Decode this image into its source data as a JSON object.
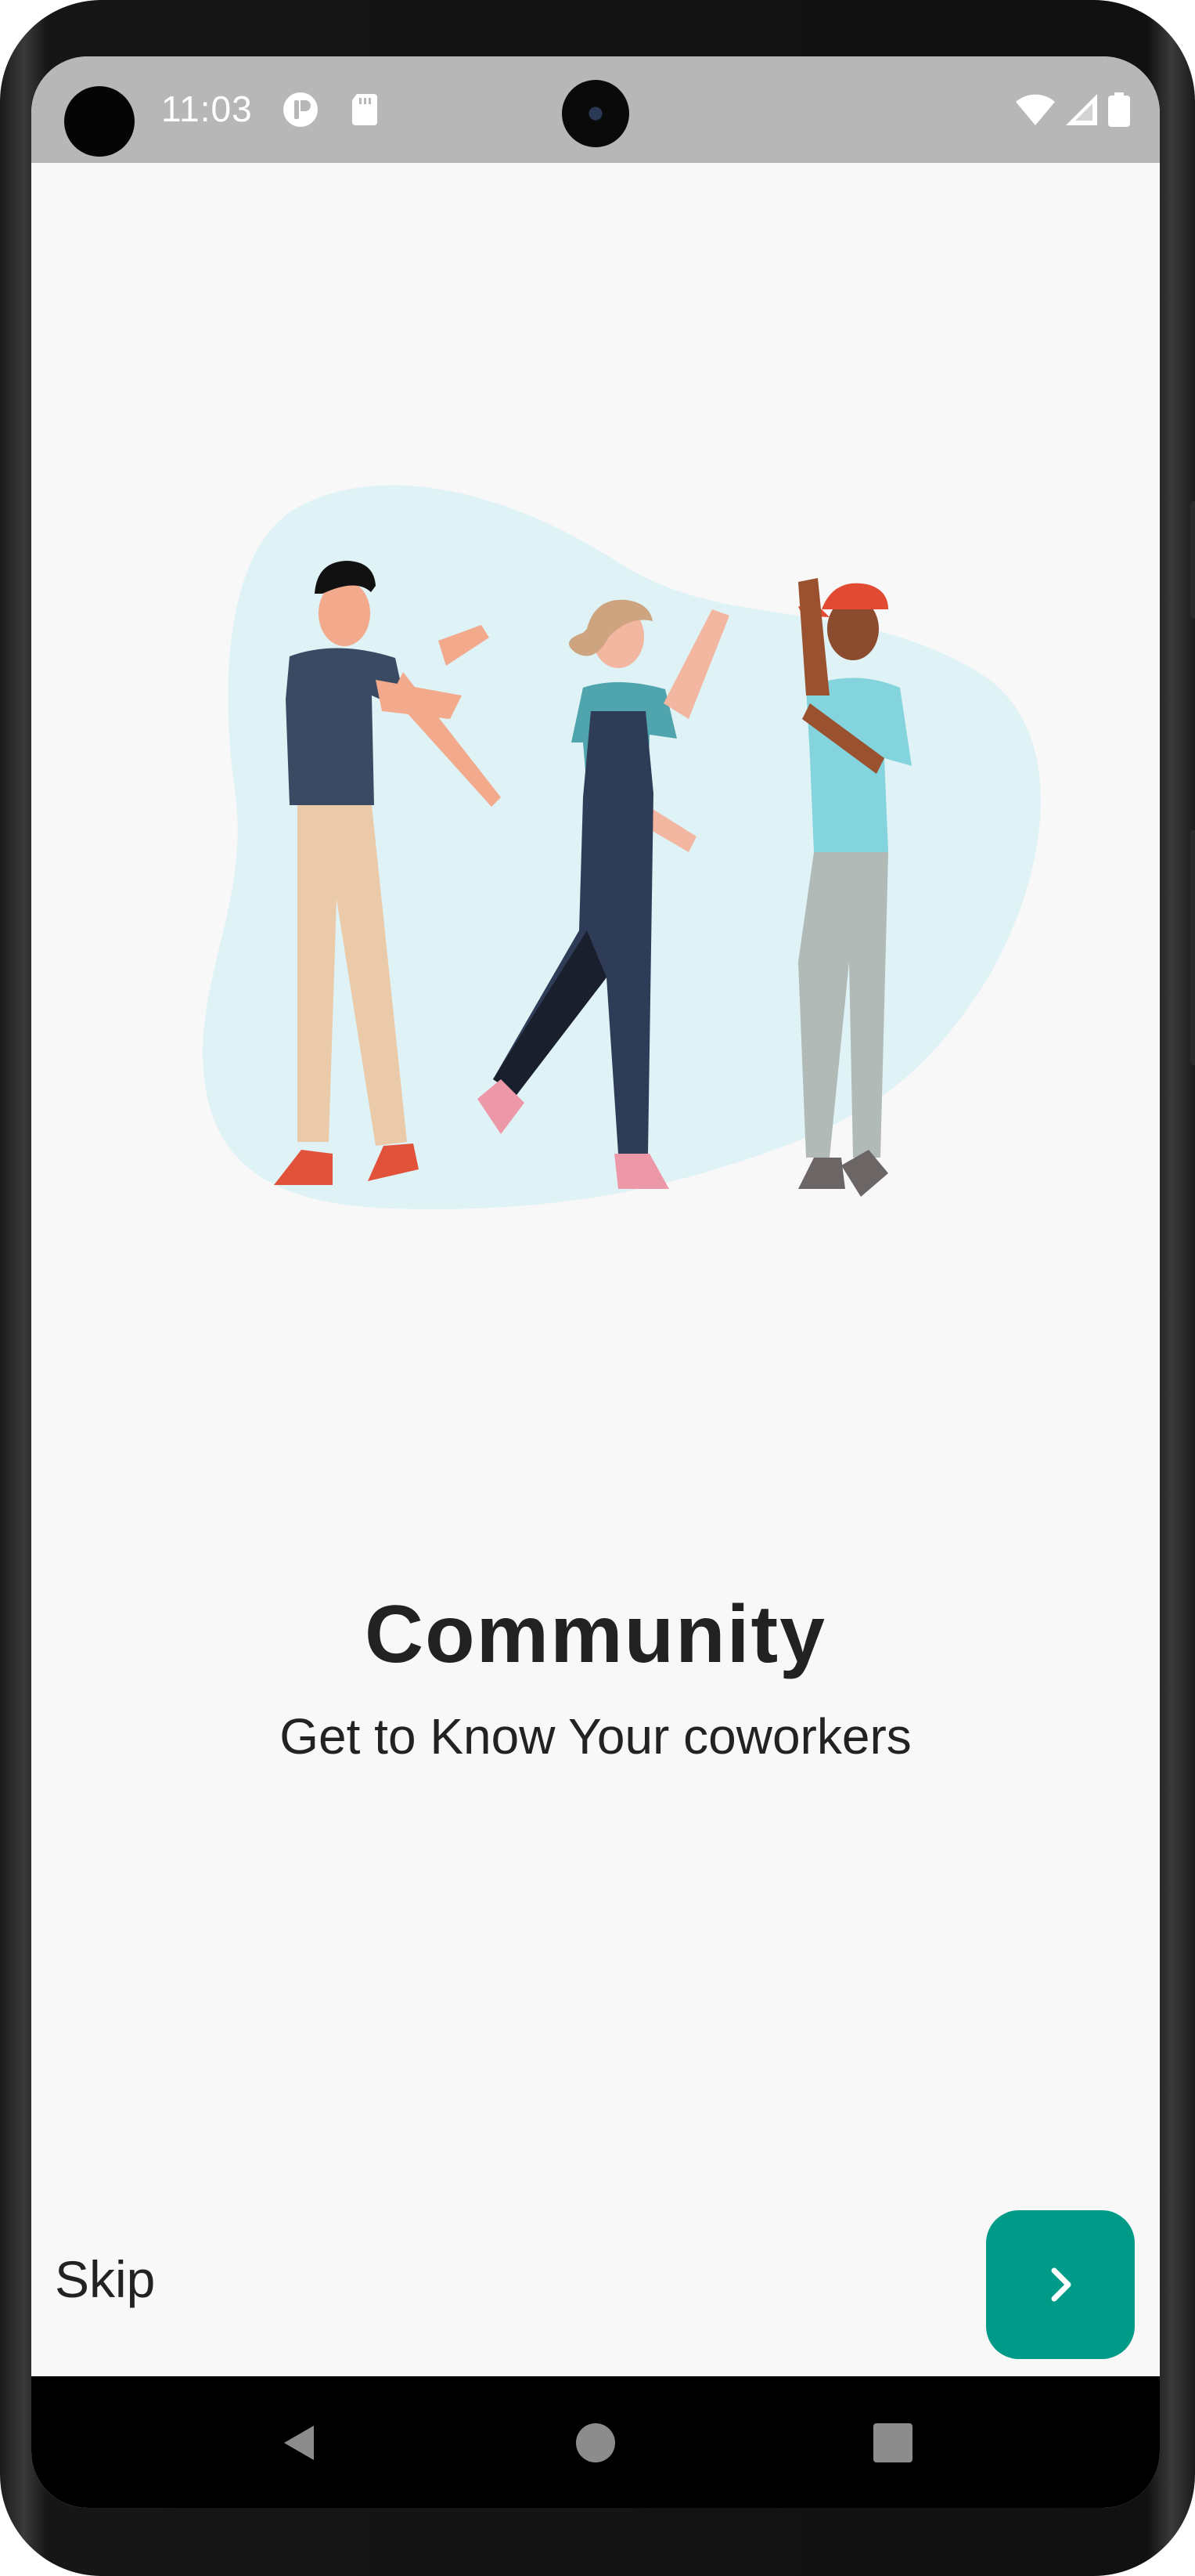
{
  "status_bar": {
    "time": "11:03",
    "icons": [
      "app-notification-icon",
      "sd-card-icon",
      "wifi-icon",
      "cell-signal-icon",
      "battery-icon"
    ],
    "background_color": "#b7b7b7"
  },
  "onboarding": {
    "illustration": "three-people-community-illustration",
    "title": "Community",
    "subtitle": "Get to Know Your coworkers",
    "skip_label": "Skip",
    "next_icon": "chevron-right-icon",
    "accent_color": "#009a88",
    "blob_color": "#dff2f5"
  },
  "nav_bar": {
    "buttons": [
      "back-icon",
      "home-icon",
      "recents-icon"
    ]
  }
}
